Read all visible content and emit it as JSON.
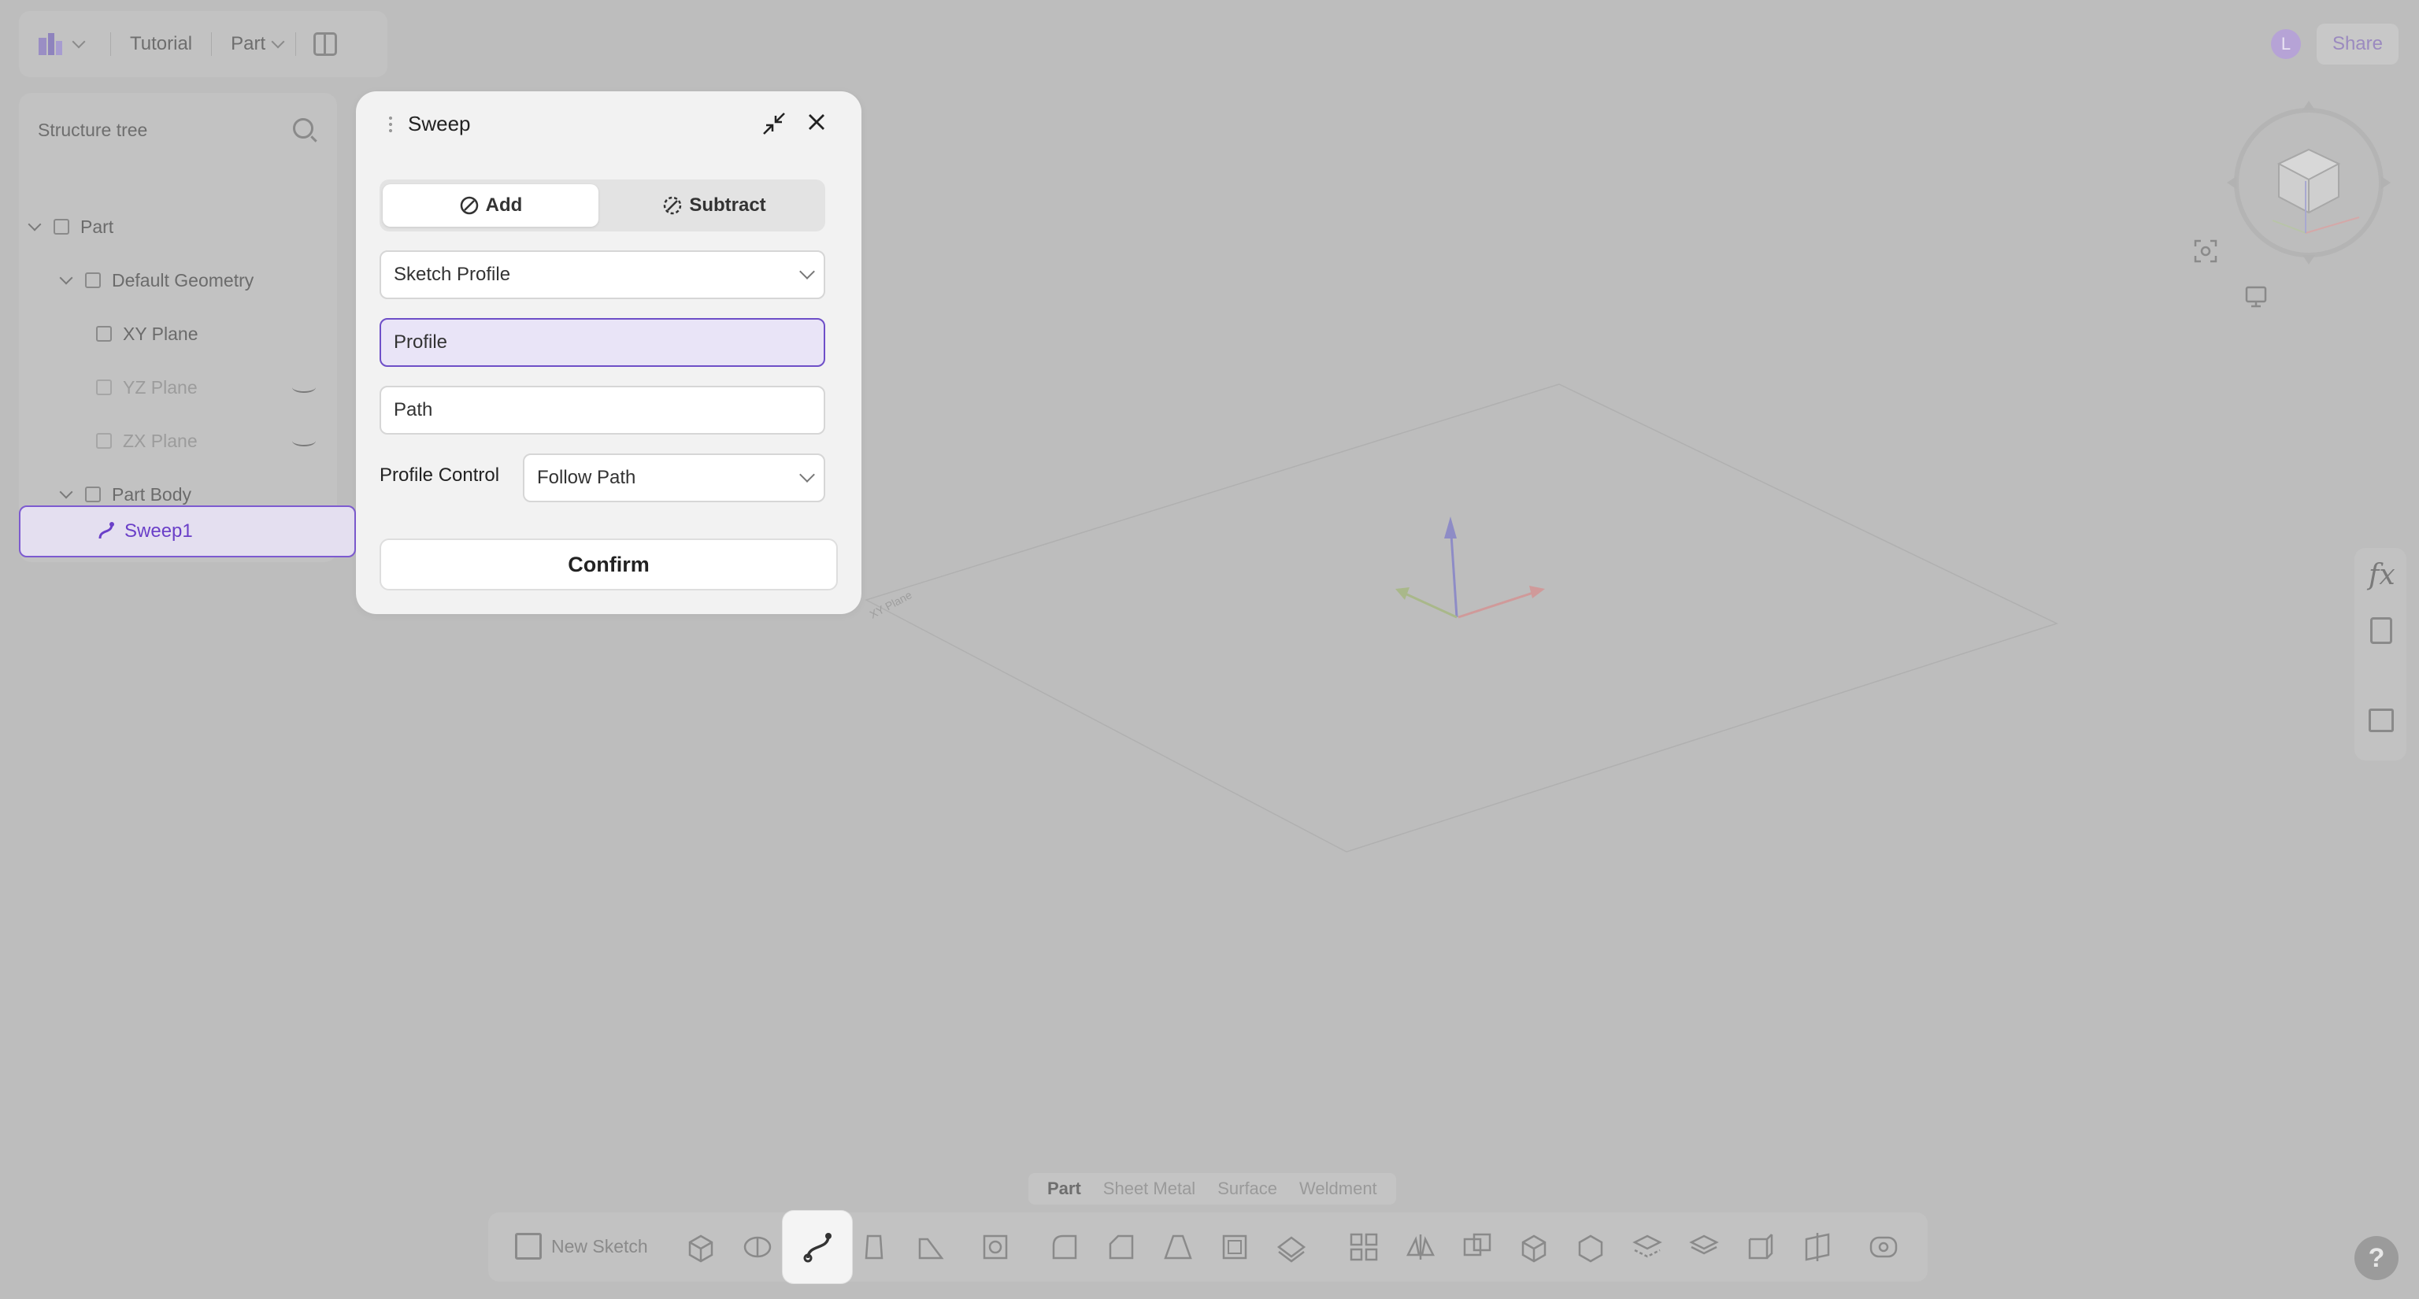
{
  "topbar": {
    "project": "Tutorial",
    "mode": "Part"
  },
  "account": {
    "avatar_initial": "L",
    "share_label": "Share"
  },
  "tree": {
    "search_placeholder": "Structure tree",
    "items": [
      {
        "label": "Part"
      },
      {
        "label": "Default Geometry"
      },
      {
        "label": "XY Plane"
      },
      {
        "label": "YZ Plane"
      },
      {
        "label": "ZX Plane"
      },
      {
        "label": "Part Body"
      },
      {
        "label": "Sweep1"
      }
    ]
  },
  "dialog": {
    "title": "Sweep",
    "add_label": "Add",
    "subtract_label": "Subtract",
    "profile_type": "Sketch Profile",
    "profile_field": "Profile",
    "path_field": "Path",
    "profile_control_label": "Profile Control",
    "profile_control_value": "Follow Path",
    "confirm_label": "Confirm"
  },
  "viewport": {
    "plane_label": "XY Plane"
  },
  "modetabs": [
    "Part",
    "Sheet Metal",
    "Surface",
    "Weldment"
  ],
  "toolbar": {
    "new_sketch_label": "New Sketch"
  },
  "help_label": "?",
  "colors": {
    "accent": "#6e4fc8",
    "selection_bg": "#e4dff0",
    "dim_overlay": "#bdbdbd"
  }
}
